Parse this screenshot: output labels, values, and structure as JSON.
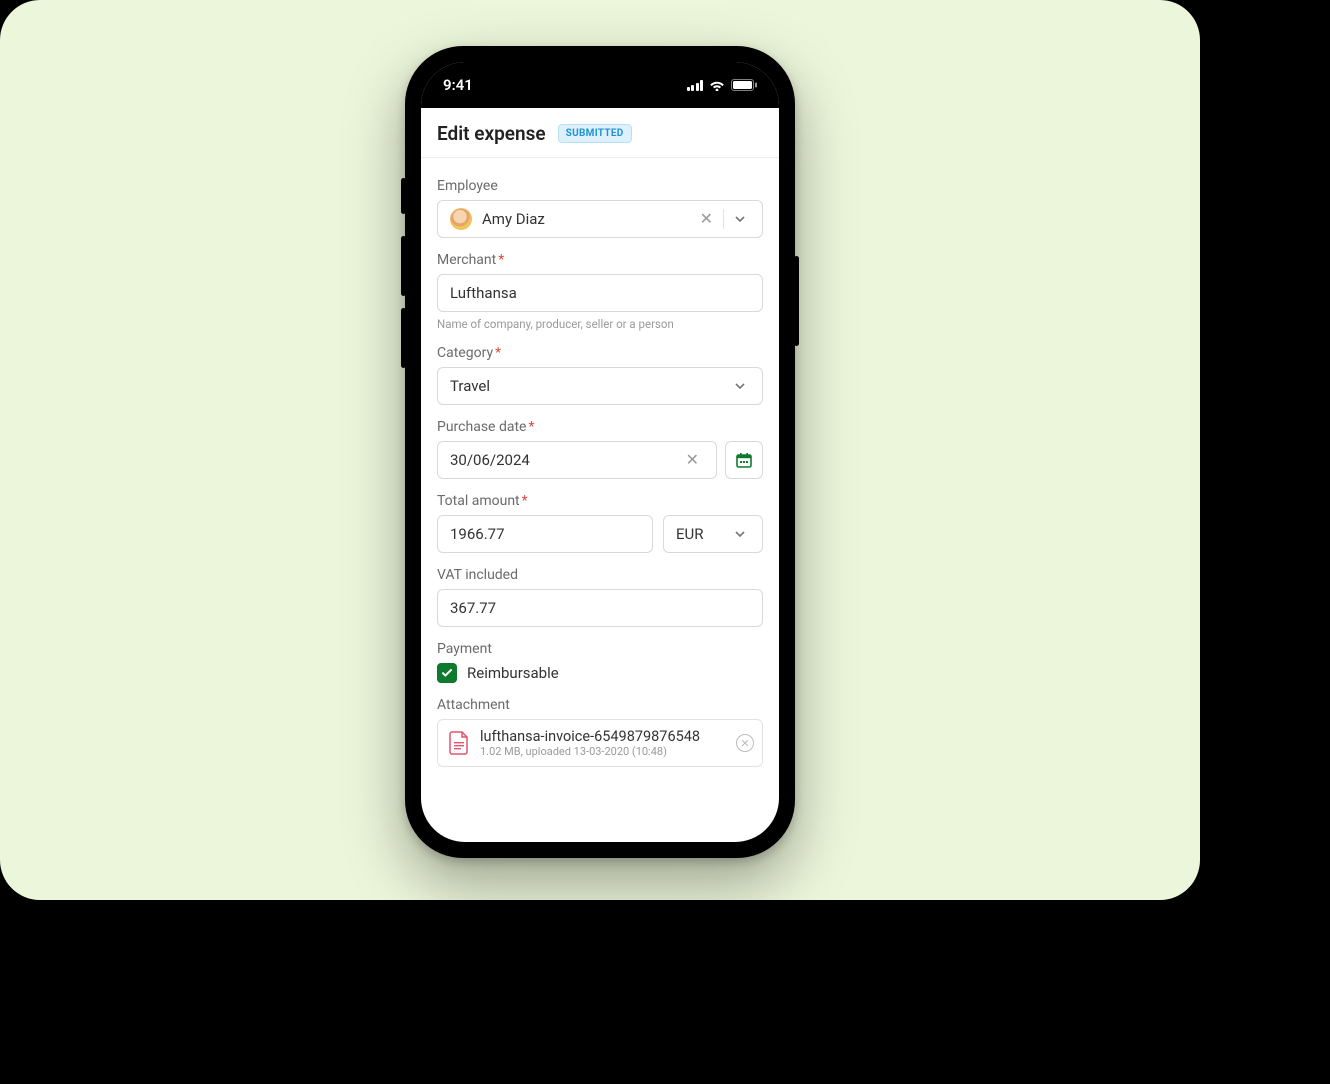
{
  "status_bar": {
    "time": "9:41"
  },
  "header": {
    "title": "Edit expense",
    "status_badge": "SUBMITTED"
  },
  "form": {
    "employee": {
      "label": "Employee",
      "value": "Amy Diaz"
    },
    "merchant": {
      "label": "Merchant",
      "value": "Lufthansa",
      "helper": "Name of company, producer, seller or a person"
    },
    "category": {
      "label": "Category",
      "value": "Travel"
    },
    "purchase_date": {
      "label": "Purchase date",
      "value": "30/06/2024"
    },
    "total_amount": {
      "label": "Total amount",
      "value": "1966.77",
      "currency": "EUR"
    },
    "vat": {
      "label": "VAT included",
      "value": "367.77"
    },
    "payment": {
      "label": "Payment",
      "checkbox_label": "Reimbursable"
    },
    "attachment": {
      "label": "Attachment",
      "file_name": "lufthansa-invoice-6549879876548",
      "meta": "1.02 MB, uploaded 13-03-2020 (10:48)"
    }
  },
  "colors": {
    "accent_green": "#0f7a2e",
    "badge_blue": "#1f93d6"
  }
}
